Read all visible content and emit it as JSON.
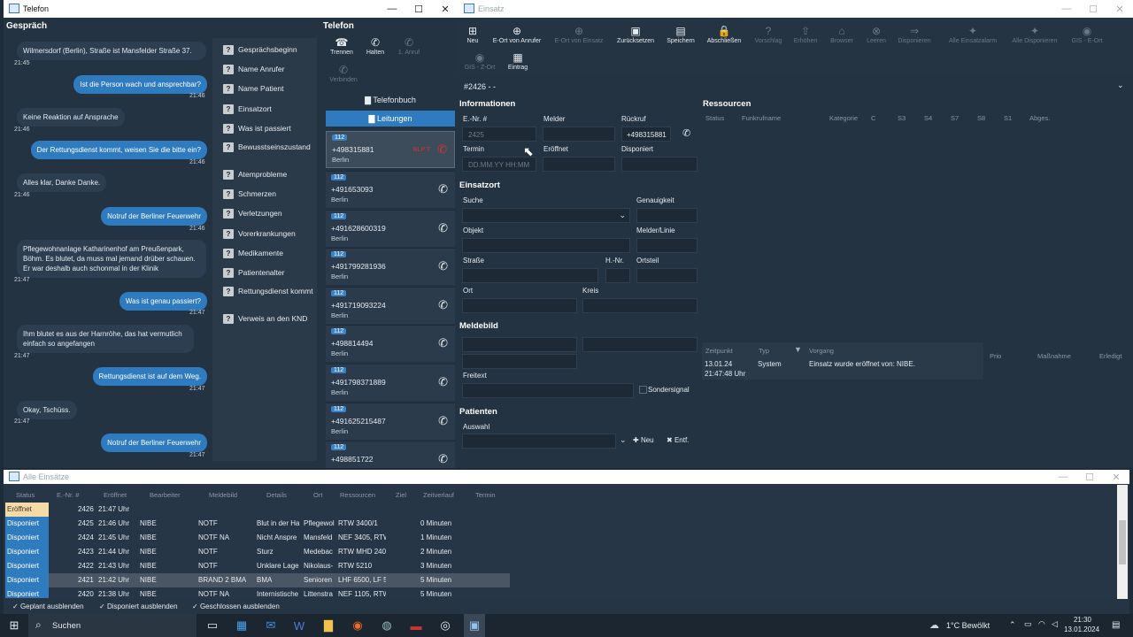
{
  "telefon_window": {
    "title": "Telefon",
    "min": "—",
    "max": "☐",
    "close": "✕"
  },
  "gespraech": {
    "heading": "Gespräch",
    "messages": [
      {
        "text": "Wilmersdorf (Berlin), Straße ist Mansfelder Straße 37.",
        "time": "21:45"
      },
      {
        "text": "Ist die Person wach und ansprechbar?",
        "time": "21:46"
      },
      {
        "text": "Keine Reaktion auf Ansprache",
        "time": "21:46"
      },
      {
        "text": "Der Rettungsdienst kommt, weisen Sie die bitte ein?",
        "time": "21:46"
      },
      {
        "text": "Alles klar, Danke Danke.",
        "time": "21:46"
      },
      {
        "text": "Notruf der Berliner Feuerwehr",
        "time": "21:46"
      },
      {
        "text": "Pflegewohnanlage Katharinenhof am Preußenpark, Böhm. Es blutet, da muss mal jemand drüber schauen. Er war deshalb auch schonmal in der Klinik",
        "time": "21:47"
      },
      {
        "text": "Was ist genau passiert?",
        "time": "21:47"
      },
      {
        "text": "Ihm blutet es aus der Harnröhe, das hat vermutlich einfach so angefangen",
        "time": "21:47"
      },
      {
        "text": "Rettungsdienst ist auf dem Weg.",
        "time": "21:47"
      },
      {
        "text": "Okay, Tschüss.",
        "time": "21:47"
      },
      {
        "text": "Notruf der Berliner Feuerwehr",
        "time": "21:47"
      }
    ]
  },
  "questions": [
    "Gesprächsbeginn",
    "Name Anrufer",
    "Name Patient",
    "Einsatzort",
    "Was ist passiert",
    "Bewusstseinszustand",
    "Atemprobleme",
    "Schmerzen",
    "Verletzungen",
    "Vorerkrankungen",
    "Medikamente",
    "Patientenalter",
    "Rettungsdienst kommt",
    "Verweis an den KND"
  ],
  "telefon_panel": {
    "heading": "Telefon",
    "buttons": {
      "trennen": "Trennen",
      "halten": "Halten",
      "anruf": "1. Anruf",
      "verbinden": "Verbinden"
    },
    "telefonbuch": "Telefonbuch",
    "leitungen": "Leitungen",
    "calls": [
      {
        "badge": "112",
        "number": "+498315881",
        "city": "Berlin",
        "tag": "BLP T"
      },
      {
        "badge": "112",
        "number": "+491653093",
        "city": "Berlin"
      },
      {
        "badge": "112",
        "number": "+491628600319",
        "city": "Berlin"
      },
      {
        "badge": "112",
        "number": "+491799281936",
        "city": "Berlin"
      },
      {
        "badge": "112",
        "number": "+491719093224",
        "city": "Berlin"
      },
      {
        "badge": "112",
        "number": "+498814494",
        "city": "Berlin"
      },
      {
        "badge": "112",
        "number": "+491798371889",
        "city": "Berlin"
      },
      {
        "badge": "112",
        "number": "+491625215487",
        "city": "Berlin"
      },
      {
        "badge": "112",
        "number": "+498851722",
        "city": ""
      }
    ]
  },
  "einsatz_window": {
    "title": "Einsatz",
    "toolbar": [
      {
        "label": "Neu",
        "icon": "⊞",
        "enabled": true
      },
      {
        "label": "E-Ort von Anrufer",
        "icon": "⊕",
        "enabled": true
      },
      {
        "label": "E-Ort von Einsatz",
        "icon": "⊕",
        "enabled": false
      },
      {
        "label": "Zurücksetzen",
        "icon": "▣",
        "enabled": true
      },
      {
        "label": "Speichern",
        "icon": "▤",
        "enabled": true
      },
      {
        "label": "Abschließen",
        "icon": "🔒",
        "enabled": true
      },
      {
        "label": "Vorschlag",
        "icon": "?",
        "enabled": false
      },
      {
        "label": "Erhöhen",
        "icon": "⇧",
        "enabled": false
      },
      {
        "label": "Browser",
        "icon": "⌂",
        "enabled": false
      },
      {
        "label": "Leeren",
        "icon": "⊗",
        "enabled": false
      },
      {
        "label": "Disponieren",
        "icon": "⇒",
        "enabled": false
      },
      {
        "label": "Alle Einsatzalarm",
        "icon": "✦",
        "enabled": false
      },
      {
        "label": "Alle Disponieren",
        "icon": "✦",
        "enabled": false
      },
      {
        "label": "GIS - E-Ort",
        "icon": "◉",
        "enabled": false
      },
      {
        "label": "GIS - Z-Ort",
        "icon": "◉",
        "enabled": false
      },
      {
        "label": "Eintrag",
        "icon": "▦",
        "enabled": true
      }
    ],
    "incident_id": "#2426 - -",
    "informationen": {
      "heading": "Informationen",
      "enr_label": "E.-Nr. #",
      "enr_value": "2425",
      "melder_label": "Melder",
      "rueckruf_label": "Rückruf",
      "rueckruf_value": "+498315881",
      "termin_label": "Termin",
      "termin_placeholder": "DD.MM.YY HH:MM",
      "eroeffnet_label": "Eröffnet",
      "disponiert_label": "Disponiert"
    },
    "einsatzort": {
      "heading": "Einsatzort",
      "suche": "Suche",
      "genauigkeit": "Genauigkeit",
      "objekt": "Objekt",
      "melder_linie": "Melder/Linie",
      "strasse": "Straße",
      "hnr": "H.-Nr.",
      "ortsteil": "Ortsteil",
      "ort": "Ort",
      "kreis": "Kreis"
    },
    "meldebild": {
      "heading": "Meldebild",
      "freitext": "Freitext",
      "sondersignal": "Sondersignal"
    },
    "patienten": {
      "heading": "Patienten",
      "auswahl": "Auswahl",
      "neu": "Neu",
      "entf": "Entf."
    },
    "ressourcen": {
      "heading": "Ressourcen",
      "columns": [
        "Status",
        "Funkrufname",
        "Kategorie",
        "C",
        "S3",
        "S4",
        "S7",
        "S8",
        "S1",
        "Abges."
      ]
    },
    "verlauf": {
      "columns": [
        "Zeitpunkt",
        "Typ",
        "Vorgang",
        "Prio",
        "Maßnahme",
        "Erledigt"
      ],
      "date": "13.01.24",
      "time": "21:47:48 Uhr",
      "typ": "System",
      "vorgang": "Einsatz wurde eröffnet von: NIBE."
    }
  },
  "alle_einsaetze": {
    "title": "Alle Einsätze",
    "columns": [
      "Status",
      "E.-Nr. #",
      "Eröffnet",
      "Bearbeiter",
      "Meldebild",
      "Details",
      "Ort",
      "Ressourcen",
      "Ziel",
      "Zeitverlauf",
      "Termin"
    ],
    "rows": [
      {
        "status": "Eröffnet",
        "nr": "2426",
        "time": "21:47 Uhr",
        "bearb": "",
        "meldebild": "",
        "details": "",
        "ort": "",
        "res": "",
        "zeit": ""
      },
      {
        "status": "Disponiert",
        "nr": "2425",
        "time": "21:46 Uhr",
        "bearb": "NIBE",
        "meldebild": "NOTF",
        "details": "Blut in der Ha",
        "ort": "Pflegewol",
        "res": "RTW 3400/1",
        "zeit": "0 Minuten"
      },
      {
        "status": "Disponiert",
        "nr": "2424",
        "time": "21:45 Uhr",
        "bearb": "NIBE",
        "meldebild": "NOTF NA",
        "details": "Nicht Anspre",
        "ort": "Mansfeld",
        "res": "NEF 3405, RTW",
        "zeit": "1 Minuten"
      },
      {
        "status": "Disponiert",
        "nr": "2423",
        "time": "21:44 Uhr",
        "bearb": "NIBE",
        "meldebild": "NOTF",
        "details": "Sturz",
        "ort": "Medebac",
        "res": "RTW MHD 240",
        "zeit": "2 Minuten"
      },
      {
        "status": "Disponiert",
        "nr": "2422",
        "time": "21:43 Uhr",
        "bearb": "NIBE",
        "meldebild": "NOTF",
        "details": "Unklare Lage",
        "ort": "Nikolaus-",
        "res": "RTW 5210",
        "zeit": "3 Minuten"
      },
      {
        "status": "Disponiert",
        "nr": "2421",
        "time": "21:42 Uhr",
        "bearb": "NIBE",
        "meldebild": "BRAND 2 BMA",
        "details": "BMA",
        "ort": "Senioren",
        "res": "LHF 6500, LF 5",
        "zeit": "5 Minuten"
      },
      {
        "status": "Disponiert",
        "nr": "2420",
        "time": "21:38 Uhr",
        "bearb": "NIBE",
        "meldebild": "NOTF NA",
        "details": "Internistische",
        "ort": "Littenstra",
        "res": "NEF 1105, RTW",
        "zeit": "5 Minuten"
      }
    ],
    "filters": [
      "Geplant ausblenden",
      "Disponiert ausblenden",
      "Geschlossen ausblenden"
    ]
  },
  "taskbar": {
    "search": "Suchen",
    "weather": "1°C  Bewölkt",
    "time": "21:30",
    "date": "13.01.2024"
  }
}
